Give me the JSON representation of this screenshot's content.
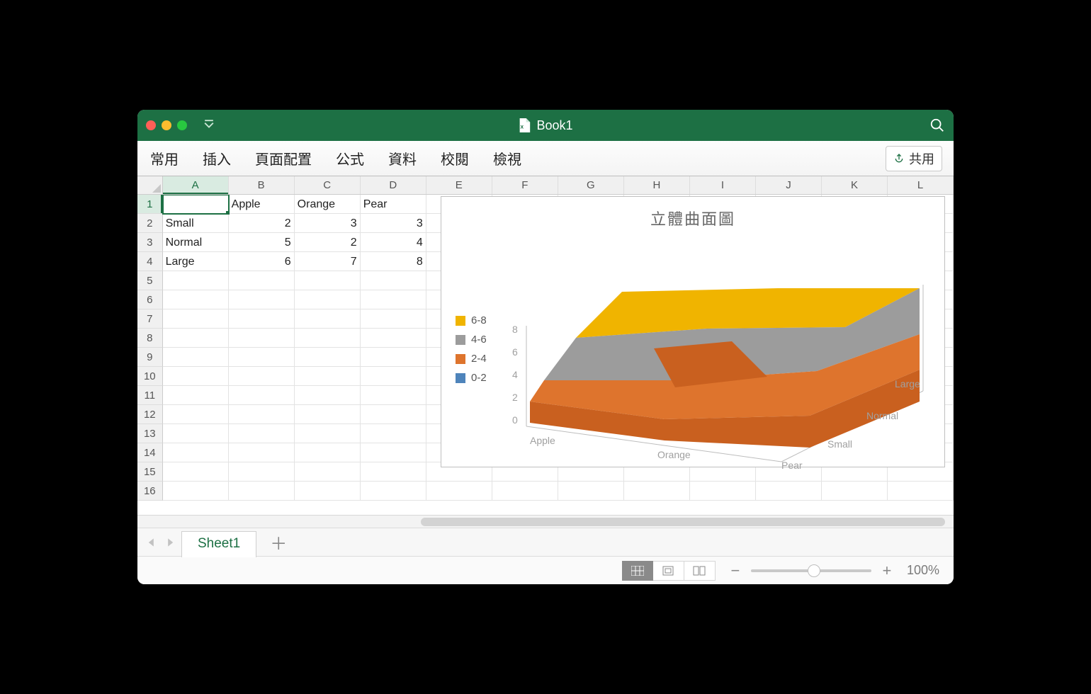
{
  "window": {
    "title": "Book1"
  },
  "ribbon": {
    "tabs": [
      "常用",
      "插入",
      "頁面配置",
      "公式",
      "資料",
      "校閱",
      "檢視"
    ],
    "share_label": "共用"
  },
  "columns": [
    "A",
    "B",
    "C",
    "D",
    "E",
    "F",
    "G",
    "H",
    "I",
    "J",
    "K",
    "L"
  ],
  "active_col": "A",
  "active_row": 1,
  "rows": [
    1,
    2,
    3,
    4,
    5,
    6,
    7,
    8,
    9,
    10,
    11,
    12,
    13,
    14,
    15,
    16
  ],
  "cells": {
    "B1": "Apple",
    "C1": "Orange",
    "D1": "Pear",
    "A2": "Small",
    "B2": "2",
    "C2": "3",
    "D2": "3",
    "A3": "Normal",
    "B3": "5",
    "C3": "2",
    "D3": "4",
    "A4": "Large",
    "B4": "6",
    "C4": "7",
    "D4": "8"
  },
  "chart_data": {
    "type": "surface3d",
    "title": "立體曲面圖",
    "x_categories": [
      "Apple",
      "Orange",
      "Pear"
    ],
    "y_categories": [
      "Small",
      "Normal",
      "Large"
    ],
    "z_values": [
      [
        2,
        3,
        3
      ],
      [
        5,
        2,
        4
      ],
      [
        6,
        7,
        8
      ]
    ],
    "z_axis_ticks": [
      0,
      2,
      4,
      6,
      8
    ],
    "legend": [
      {
        "label": "6-8",
        "color": "#f0b400"
      },
      {
        "label": "4-6",
        "color": "#9c9c9c"
      },
      {
        "label": "2-4",
        "color": "#de742d"
      },
      {
        "label": "0-2",
        "color": "#4e84bb"
      }
    ]
  },
  "sheet": {
    "active": "Sheet1"
  },
  "status": {
    "zoom": "100%"
  }
}
